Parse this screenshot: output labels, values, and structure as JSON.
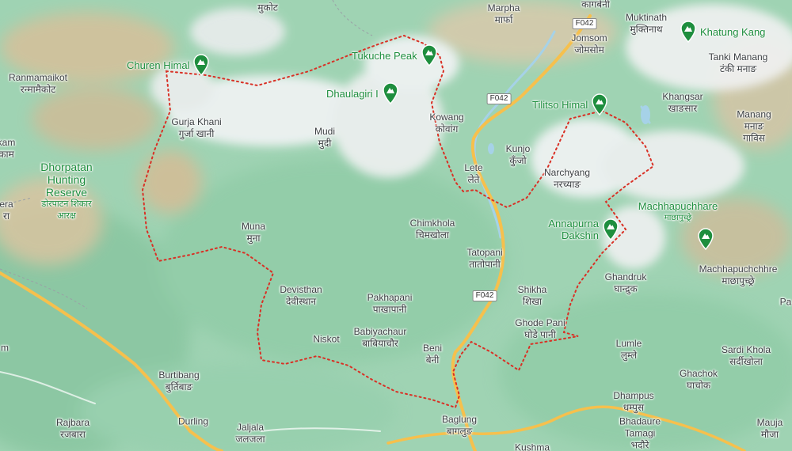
{
  "map": {
    "colors": {
      "land": "#9fd3b3",
      "forest": "#8fcba6",
      "snow": "#f1f3f4",
      "terrain": "#d9c4a0",
      "boundary": "#d93025",
      "road_primary": "#f6c04d",
      "poi": "#1e8e3e"
    },
    "places": [
      {
        "id": "mukot",
        "en": "मुकोट",
        "ne": ""
      },
      {
        "id": "marpha",
        "en": "Marpha",
        "ne": "मार्फा"
      },
      {
        "id": "kagbeni",
        "en": "कागबेनी",
        "ne": ""
      },
      {
        "id": "muktinath",
        "en": "Muktinath",
        "ne": "मुक्तिनाथ"
      },
      {
        "id": "jomsom",
        "en": "Jomsom",
        "ne": "जोमसोम"
      },
      {
        "id": "tanki_manang",
        "en": "Tanki Manang",
        "ne": "टंकी मनाङ"
      },
      {
        "id": "ranmamaikot",
        "en": "Ranmamaikot",
        "ne": "रन्मामैकोट"
      },
      {
        "id": "gurja_khani",
        "en": "Gurja Khani",
        "ne": "गुर्जा खानी"
      },
      {
        "id": "kowang",
        "en": "Kowang",
        "ne": "कोवांग"
      },
      {
        "id": "khangsar",
        "en": "Khangsar",
        "ne": "खाङसार"
      },
      {
        "id": "manang",
        "en": "Manang",
        "ne": "मनाङ गाविस"
      },
      {
        "id": "mudi",
        "en": "Mudi",
        "ne": "मुदी"
      },
      {
        "id": "kam",
        "en": "kam",
        "ne": "काम"
      },
      {
        "id": "dhorpatan",
        "en": "Dhorpatan Hunting Reserve",
        "ne": "डोरपाटन शिकार आरक्ष"
      },
      {
        "id": "kunjo",
        "en": "Kunjo",
        "ne": "कुँजो"
      },
      {
        "id": "lete",
        "en": "Lete",
        "ne": "लेते"
      },
      {
        "id": "narchyang",
        "en": "Narchyang",
        "ne": "नरच्याङ"
      },
      {
        "id": "era",
        "en": "era",
        "ne": "रा"
      },
      {
        "id": "chimkhola",
        "en": "Chimkhola",
        "ne": "चिमखोला"
      },
      {
        "id": "muna",
        "en": "Muna",
        "ne": "मुना"
      },
      {
        "id": "tatopani",
        "en": "Tatopani",
        "ne": "तातोपानी"
      },
      {
        "id": "machhapuchchhre",
        "en": "Machhapuchchhre",
        "ne": "माछापुच्छ्रे"
      },
      {
        "id": "ghandruk",
        "en": "Ghandruk",
        "ne": "घान्द्रुक"
      },
      {
        "id": "devisthan",
        "en": "Devisthan",
        "ne": "देवीस्थान"
      },
      {
        "id": "shikha",
        "en": "Shikha",
        "ne": "शिखा"
      },
      {
        "id": "pakhapani",
        "en": "Pakhapani",
        "ne": "पाखापानी"
      },
      {
        "id": "pa",
        "en": "Pa",
        "ne": ""
      },
      {
        "id": "ghode_pani",
        "en": "Ghode Pani",
        "ne": "घोडे पानी"
      },
      {
        "id": "niskot",
        "en": "Niskot",
        "ne": ""
      },
      {
        "id": "babiyachaur",
        "en": "Babiyachaur",
        "ne": "बाबियाचौर"
      },
      {
        "id": "lumle",
        "en": "Lumle",
        "ne": "लुम्ले"
      },
      {
        "id": "sardi_khola",
        "en": "Sardi Khola",
        "ne": "सर्दीखोला"
      },
      {
        "id": "m_left",
        "en": "m",
        "ne": ""
      },
      {
        "id": "beni",
        "en": "Beni",
        "ne": "बेनी"
      },
      {
        "id": "burtibang",
        "en": "Burtibang",
        "ne": "बुर्तिबाङ"
      },
      {
        "id": "ghachok",
        "en": "Ghachok",
        "ne": "घाचोक"
      },
      {
        "id": "dhampus",
        "en": "Dhampus",
        "ne": "धम्पुस"
      },
      {
        "id": "rajbara",
        "en": "Rajbara",
        "ne": "रजबारा"
      },
      {
        "id": "durling",
        "en": "Durling",
        "ne": ""
      },
      {
        "id": "bhadaure",
        "en": "Bhadaure Tamagi",
        "ne": "भदौरे"
      },
      {
        "id": "mauja",
        "en": "Mauja",
        "ne": "मौजा"
      },
      {
        "id": "jaljala",
        "en": "Jaljala",
        "ne": "जलजला"
      },
      {
        "id": "baglung",
        "en": "Baglung",
        "ne": "बागलुङ"
      },
      {
        "id": "kushma",
        "en": "Kushma",
        "ne": ""
      }
    ],
    "pois": [
      {
        "id": "churen_himal",
        "name": "Churen Himal",
        "icon": "mountain-pin-icon"
      },
      {
        "id": "tukuche_peak",
        "name": "Tukuche Peak",
        "icon": "mountain-pin-icon"
      },
      {
        "id": "khatung_kang",
        "name": "Khatung Kang",
        "icon": "mountain-pin-icon"
      },
      {
        "id": "dhaulagiri",
        "name": "Dhaulagiri I",
        "icon": "mountain-pin-icon"
      },
      {
        "id": "tilitso_himal",
        "name": "Tilitso Himal",
        "icon": "mountain-pin-icon"
      },
      {
        "id": "annapurna_dakshin",
        "name": "Annapurna Dakshin",
        "icon": "mountain-pin-icon"
      },
      {
        "id": "machhapuchhare",
        "name": "Machhapuchhare",
        "sub": "माछापुच्छ्रे",
        "icon": "mountain-pin-icon"
      }
    ],
    "road_shields": [
      {
        "id": "f042_a",
        "label": "F042"
      },
      {
        "id": "f042_b",
        "label": "F042"
      },
      {
        "id": "f042_c",
        "label": "F042"
      }
    ]
  }
}
